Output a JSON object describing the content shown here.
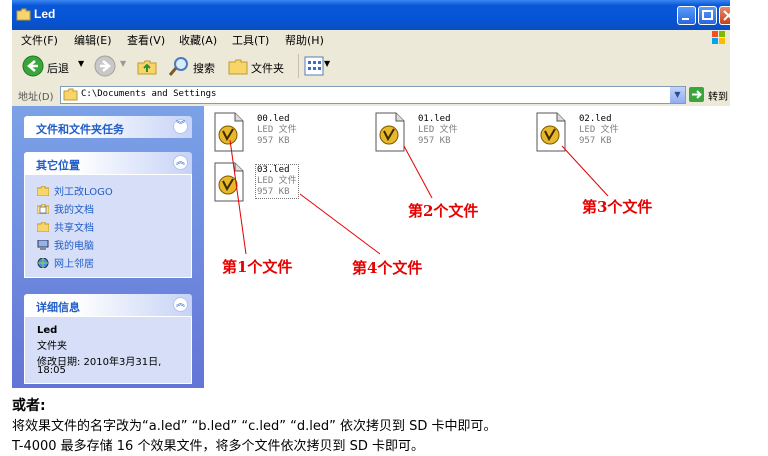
{
  "window": {
    "title": "Led",
    "menu": [
      "文件(F)",
      "编辑(E)",
      "查看(V)",
      "收藏(A)",
      "工具(T)",
      "帮助(H)"
    ],
    "toolbar": {
      "back": "后退",
      "search": "搜索",
      "folders": "文件夹"
    },
    "address": {
      "label": "地址(D)",
      "value": "C:\\Documents and Settings",
      "go": "转到"
    }
  },
  "sidebar": {
    "tasks_title": "文件和文件夹任务",
    "places_title": "其它位置",
    "places": [
      {
        "label": "刘工改LOGO",
        "icon": "folder-icon"
      },
      {
        "label": "我的文档",
        "icon": "documents-icon"
      },
      {
        "label": "共享文档",
        "icon": "shared-folder-icon"
      },
      {
        "label": "我的电脑",
        "icon": "computer-icon"
      },
      {
        "label": "网上邻居",
        "icon": "network-icon"
      }
    ],
    "details_title": "详细信息",
    "details": {
      "name": "Led",
      "type": "文件夹",
      "modified_line1": "修改日期: 2010年3月31日,",
      "modified_line2": "18:05"
    }
  },
  "files": [
    {
      "name": "00.led",
      "type": "LED 文件",
      "size": "957 KB"
    },
    {
      "name": "01.led",
      "type": "LED 文件",
      "size": "957 KB"
    },
    {
      "name": "02.led",
      "type": "LED 文件",
      "size": "957 KB"
    },
    {
      "name": "03.led",
      "type": "LED 文件",
      "size": "957 KB"
    }
  ],
  "annotations": [
    "第1个文件",
    "第2个文件",
    "第3个文件",
    "第4个文件"
  ],
  "notes": {
    "heading": "或者:",
    "line1": "将效果文件的名字改为“a.led” “b.led” “c.led” “d.led” 依次拷贝到 SD 卡中即可。",
    "line2": "T-4000 最多存储 16 个效果文件，将多个文件依次拷贝到 SD 卡即可。"
  },
  "colors": {
    "titlebar": "#0654d6",
    "sidebar": "#6f8cdf",
    "annotation": "#e60000",
    "link": "#215dc6"
  }
}
